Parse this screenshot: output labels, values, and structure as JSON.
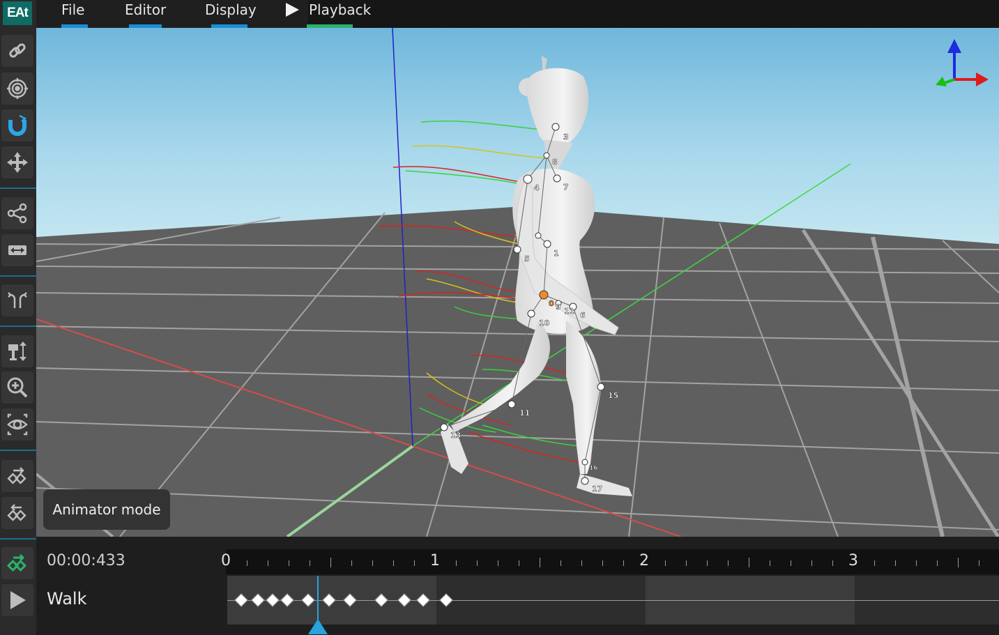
{
  "app": {
    "logo": "EAt"
  },
  "menu": [
    {
      "label": "File",
      "underline": "#1a8ed6"
    },
    {
      "label": "Editor",
      "underline": "#1a8ed6"
    },
    {
      "label": "Display",
      "underline": "#1a8ed6"
    },
    {
      "label": "Playback",
      "underline": "#2ab36a",
      "icon": "play-icon"
    }
  ],
  "toolbar": {
    "tools": [
      {
        "name": "link-tool",
        "icon": "link-icon"
      },
      {
        "name": "target-tool",
        "icon": "target-icon"
      },
      {
        "name": "magnet-tool",
        "icon": "magnet-icon",
        "active": true
      },
      {
        "name": "move-tool",
        "icon": "move-arrows-icon"
      },
      {
        "name": "share-tool",
        "icon": "share-nodes-icon"
      },
      {
        "name": "width-tool",
        "icon": "horizontal-resize-icon"
      },
      {
        "name": "mirror-tool",
        "icon": "mirror-arrows-icon"
      },
      {
        "name": "height-tool",
        "icon": "vertical-resize-icon"
      },
      {
        "name": "zoom-tool",
        "icon": "zoom-in-icon"
      },
      {
        "name": "view-tool",
        "icon": "eye-icon"
      },
      {
        "name": "keyframe-forward-tool",
        "icon": "keyframe-forward-icon"
      },
      {
        "name": "keyframe-backward-tool",
        "icon": "keyframe-backward-icon"
      },
      {
        "name": "keyframe-active-tool",
        "icon": "keyframe-active-icon",
        "active": true
      },
      {
        "name": "play-tool",
        "icon": "play-icon"
      }
    ]
  },
  "viewport": {
    "mode_label": "Animator mode",
    "joint_labels": [
      "3",
      "8",
      "4",
      "7",
      "1",
      "5",
      "0",
      "9",
      "11",
      "6",
      "10",
      "15",
      "11",
      "13",
      "16",
      "17"
    ],
    "axis_gizmo_colors": {
      "x": "#e01b1b",
      "y": "#16c016",
      "z": "#1b2be0"
    }
  },
  "timeline": {
    "current_time": "00:00:433",
    "ruler_labels": [
      "0",
      "1",
      "2",
      "3"
    ],
    "track_name": "Walk",
    "cursor_seconds": 0.433,
    "keyframes_seconds": [
      0.05,
      0.13,
      0.2,
      0.27,
      0.37,
      0.47,
      0.57,
      0.72,
      0.83,
      0.92,
      1.03
    ]
  }
}
